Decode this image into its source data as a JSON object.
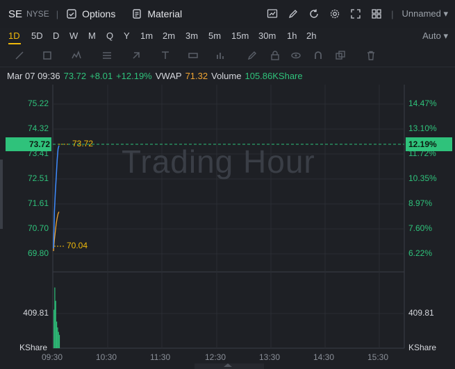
{
  "header": {
    "symbol": "SE",
    "exchange": "NYSE",
    "options_label": "Options",
    "material_label": "Material",
    "layout_name": "Unnamed"
  },
  "timeframes": {
    "items": [
      "1D",
      "5D",
      "D",
      "W",
      "M",
      "Q",
      "Y",
      "1m",
      "2m",
      "3m",
      "5m",
      "15m",
      "30m",
      "1h",
      "2h"
    ],
    "active": "1D",
    "auto_label": "Auto"
  },
  "info": {
    "datetime": "Mar 07 09:36",
    "price": "73.72",
    "change": "+8.01",
    "change_pct": "+12.19%",
    "vwap_label": "VWAP",
    "vwap_value": "71.32",
    "volume_label": "Volume",
    "volume_value": "105.86KShare"
  },
  "chart": {
    "watermark": "Trading Hour",
    "price_ticks": [
      "75.22",
      "74.32",
      "73.41",
      "72.51",
      "71.61",
      "70.70",
      "69.80"
    ],
    "pct_ticks": [
      "14.47%",
      "13.10%",
      "11.72%",
      "10.35%",
      "8.97%",
      "7.60%",
      "6.22%"
    ],
    "current_price_tag": "73.72",
    "current_pct_tag": "12.19%",
    "price_annotation": "73.72",
    "vwap_annotation": "70.04",
    "volume_tick": "409.81",
    "volume_unit": "KShare",
    "x_ticks": [
      "09:30",
      "10:30",
      "11:30",
      "12:30",
      "13:30",
      "14:30",
      "15:30"
    ]
  },
  "colors": {
    "up": "#2fc27b",
    "accent": "#f0b90b",
    "price_line": "#3f8cff",
    "vwap_line": "#f0a532"
  },
  "chart_data": {
    "type": "line",
    "price_series": {
      "x": [
        "09:30",
        "09:31",
        "09:32",
        "09:33",
        "09:34",
        "09:35",
        "09:36"
      ],
      "values": [
        70.0,
        71.3,
        72.0,
        72.6,
        73.2,
        73.6,
        73.72
      ]
    },
    "vwap_series": {
      "x": [
        "09:30",
        "09:31",
        "09:32",
        "09:33",
        "09:34",
        "09:35",
        "09:36"
      ],
      "values": [
        69.9,
        70.3,
        70.6,
        70.9,
        71.1,
        71.25,
        71.32
      ]
    },
    "ylim": [
      69.5,
      75.6
    ],
    "volume_values": [
      260,
      410,
      320,
      180,
      140,
      110,
      90
    ]
  }
}
